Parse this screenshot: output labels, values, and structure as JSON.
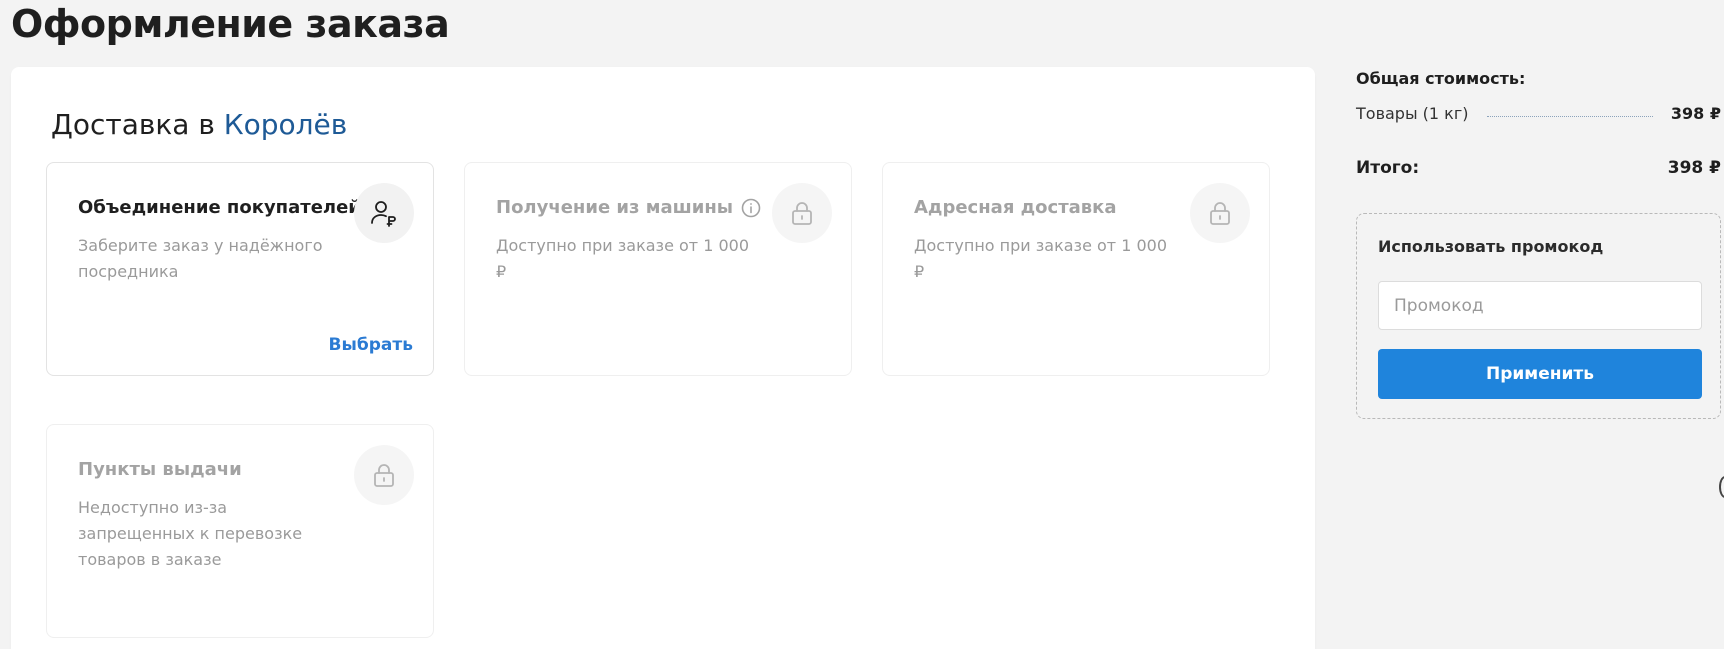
{
  "page": {
    "title": "Оформление заказа"
  },
  "delivery": {
    "heading_prefix": "Доставка в ",
    "city": "Королёв",
    "options": [
      {
        "title": "Объединение покупателей",
        "description": "Заберите заказ у надёжного посредника",
        "action_label": "Выбрать",
        "icon": "user-ruble-icon",
        "enabled": true
      },
      {
        "title": "Получение из машины",
        "description": "Доступно при заказе от 1 000 ₽",
        "icon": "lock-icon",
        "has_info_icon": true,
        "enabled": false
      },
      {
        "title": "Адресная доставка",
        "description": "Доступно при заказе от 1 000 ₽",
        "icon": "lock-icon",
        "enabled": false
      },
      {
        "title": "Пункты выдачи",
        "description": "Недоступно из-за запрещенных к перевозке товаров в заказе",
        "icon": "lock-icon",
        "enabled": false
      }
    ]
  },
  "summary": {
    "label": "Общая стоимость:",
    "goods_label": "Товары (1 кг)",
    "goods_amount": "398 ₽",
    "total_label": "Итого:",
    "total_amount": "398 ₽"
  },
  "promo": {
    "label": "Использовать промокод",
    "placeholder": "Промокод",
    "value": "",
    "button_label": "Применить"
  },
  "colors": {
    "accent": "#1f84dc",
    "link": "#2b7bd3",
    "city": "#1e5a96",
    "background": "#f3f3f3"
  }
}
